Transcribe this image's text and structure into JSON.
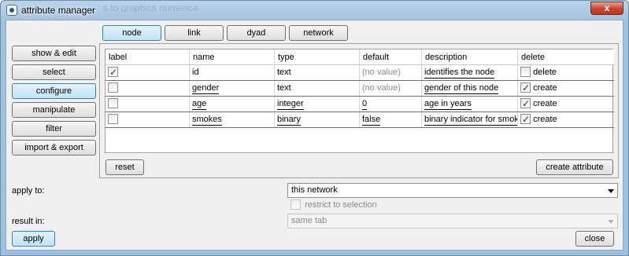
{
  "window": {
    "title": "attribute manager",
    "ghost_text": "s to graphics numerica",
    "close_glyph": "x"
  },
  "tabs": [
    {
      "label": "node",
      "active": true
    },
    {
      "label": "link",
      "active": false
    },
    {
      "label": "dyad",
      "active": false
    },
    {
      "label": "network",
      "active": false
    }
  ],
  "sidebar": [
    {
      "label": "show & edit",
      "active": false
    },
    {
      "label": "select",
      "active": false
    },
    {
      "label": "configure",
      "active": true
    },
    {
      "label": "manipulate",
      "active": false
    },
    {
      "label": "filter",
      "active": false
    },
    {
      "label": "import & export",
      "active": false
    }
  ],
  "table": {
    "columns": [
      "label",
      "name",
      "type",
      "default",
      "description",
      "delete"
    ],
    "rows": [
      {
        "label_checked": true,
        "name": "id",
        "type": "text",
        "default": "(no value)",
        "default_placeholder": true,
        "description": "identifies the node",
        "delete_checked": false,
        "delete_label": "delete"
      },
      {
        "label_checked": false,
        "name": "gender",
        "type": "text",
        "default": "(no value)",
        "default_placeholder": true,
        "description": "gender of this node",
        "delete_checked": true,
        "delete_label": "create"
      },
      {
        "label_checked": false,
        "name": "age",
        "type": "integer",
        "default": "0",
        "default_placeholder": false,
        "description": "age in years",
        "delete_checked": true,
        "delete_label": "create"
      },
      {
        "label_checked": false,
        "name": "smokes",
        "type": "binary",
        "default": "false",
        "default_placeholder": false,
        "description": "binary indicator for smoking",
        "delete_checked": true,
        "delete_label": "create"
      }
    ]
  },
  "reset_label": "reset",
  "create_attribute_label": "create attribute",
  "apply_to": {
    "label": "apply to:",
    "value": "this network"
  },
  "restrict": {
    "label": "restrict to selection",
    "checked": false
  },
  "result_in": {
    "label": "result in:",
    "value": "same tab"
  },
  "apply_label": "apply",
  "close_label": "close"
}
